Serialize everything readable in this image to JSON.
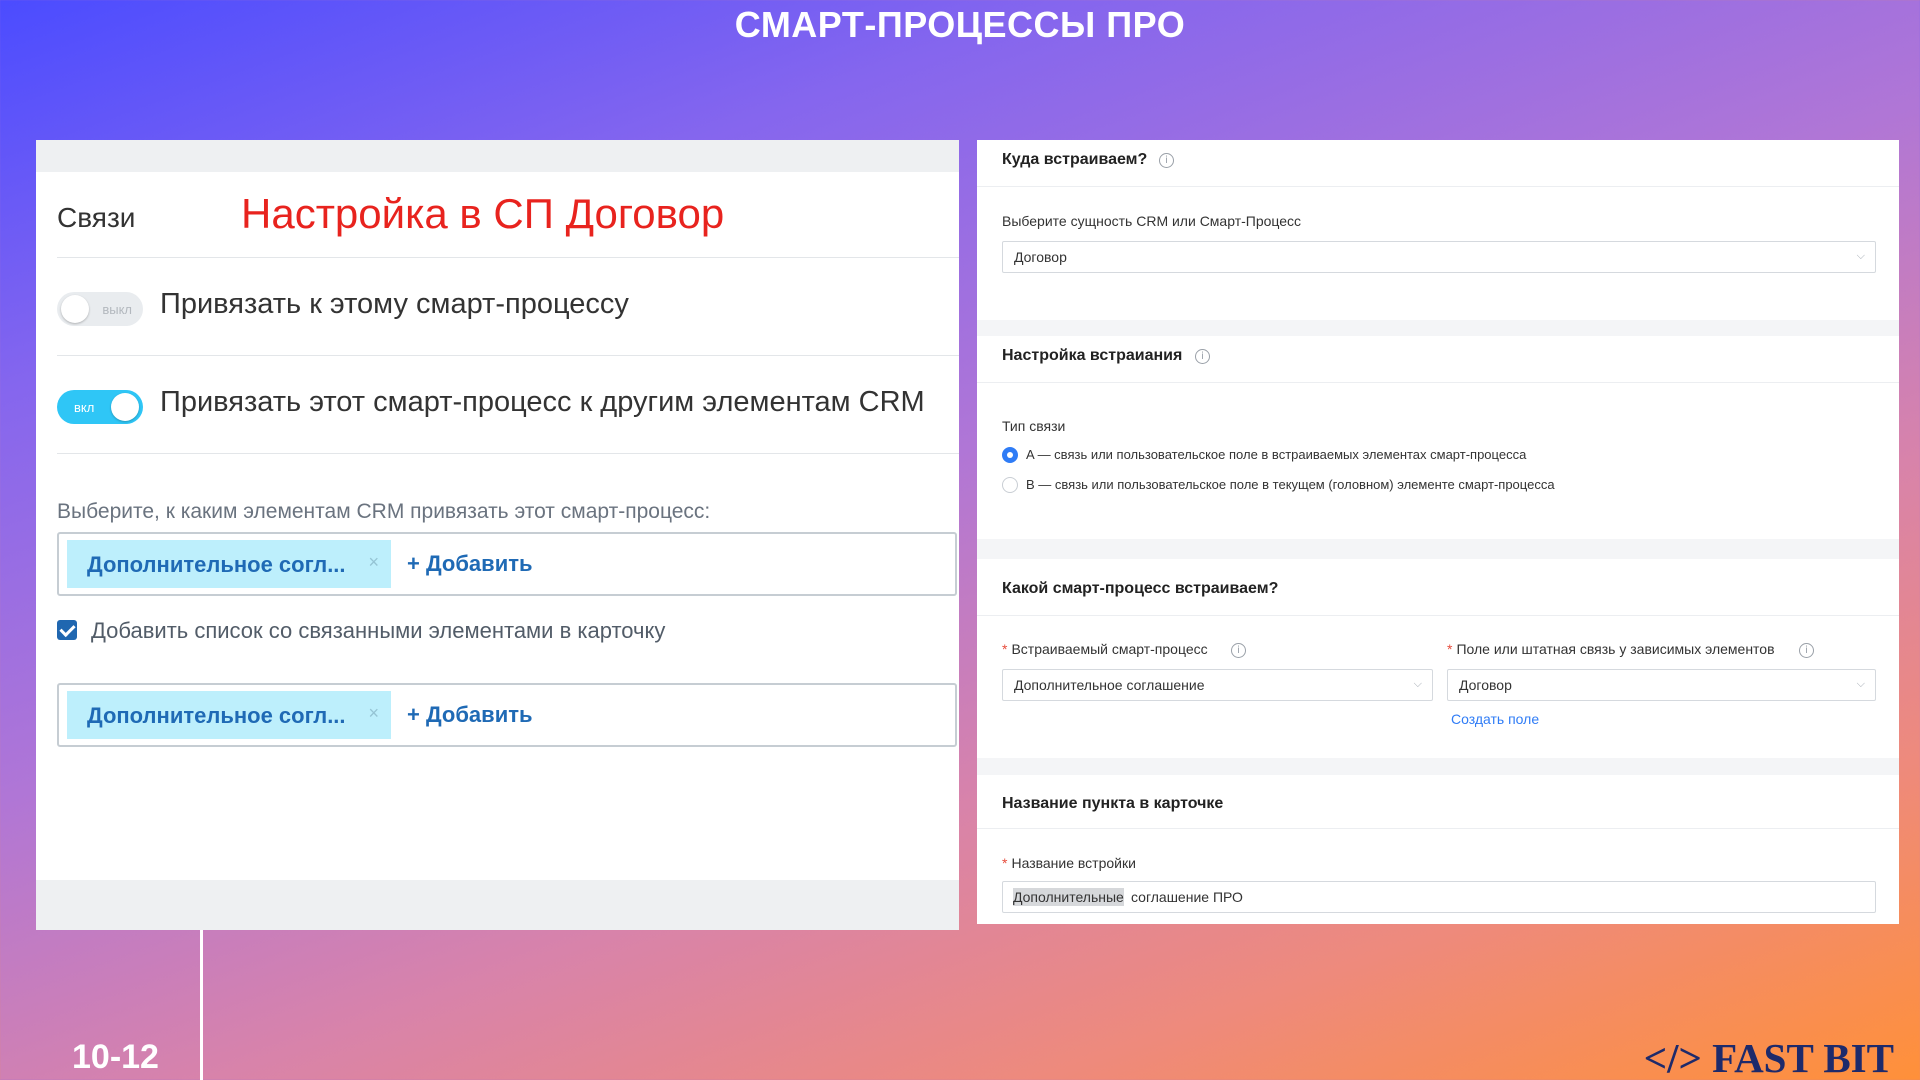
{
  "slide": {
    "title": "СМАРТ-ПРОЦЕССЫ ПРО",
    "page_number": "10-12",
    "logo_text": "</> FAST BIT"
  },
  "left": {
    "section_title": "Связи",
    "setup_title": "Настройка в СП Договор",
    "toggle1": {
      "state": "выкл",
      "label": "Привязать к этому смарт-процессу"
    },
    "toggle2": {
      "state": "вкл",
      "label": "Привязать этот смарт-процесс к другим элементам CRM"
    },
    "choose_label": "Выберите, к каким элементам CRM привязать этот смарт-процесс:",
    "tags1": {
      "tag": "Дополнительное согл...",
      "remove": "×",
      "add": "+ Добавить"
    },
    "checkbox_label": "Добавить список со связанными элементами в карточку",
    "tags2": {
      "tag": "Дополнительное согл...",
      "remove": "×",
      "add": "+ Добавить"
    }
  },
  "right": {
    "where": {
      "title": "Куда встраиваем?",
      "field_label": "Выберите сущность CRM или Смарт-Процесс",
      "field_value": "Договор"
    },
    "embed": {
      "title": "Настройка встраиания",
      "type_label": "Тип связи",
      "option_a": "A — связь или пользовательское поле в встраиваемых элементах смарт-процесса",
      "option_b": "B — связь или пользовательское поле в текущем (головном) элементе смарт-процесса"
    },
    "which": {
      "title": "Какой смарт-процесс встраиваем?",
      "field1_label": "Встраиваемый смарт-процесс",
      "field1_value": "Дополнительное соглашение",
      "field2_label": "Поле или штатная связь у зависимых элементов",
      "field2_value": "Договор",
      "create_link": "Создать поле"
    },
    "card_name": {
      "title": "Название пункта в карточке",
      "field_label": "Название встройки",
      "value_selected": "Дополнительные",
      "value_rest": "соглашение ПРО"
    }
  },
  "icons": {
    "info": "info-icon",
    "chevron": "chevron-down-icon",
    "remove": "close-icon"
  },
  "colors": {
    "accent_red": "#e8231e",
    "toggle_on": "#2fc6f6",
    "tag_bg": "#bdeffc",
    "link_blue": "#2f7cf6",
    "logo": "#1d2a6b"
  }
}
